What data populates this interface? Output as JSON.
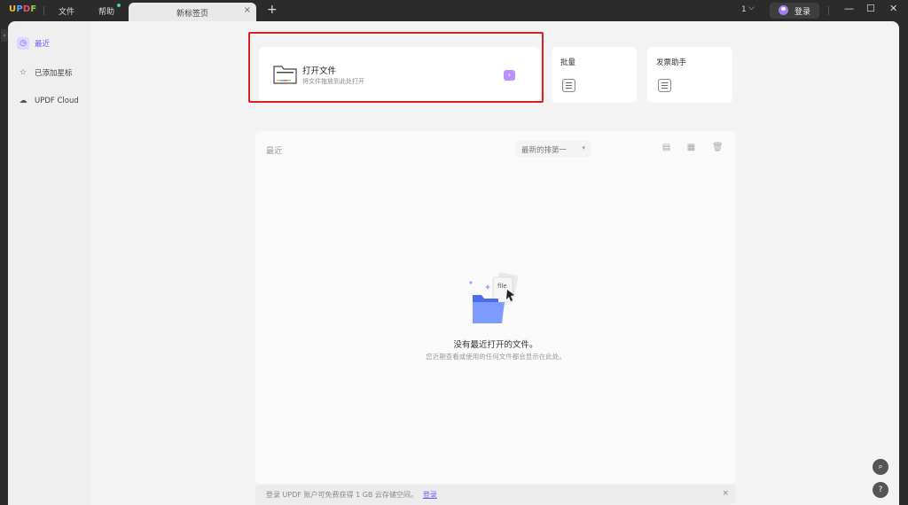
{
  "titlebar": {
    "menu_file": "文件",
    "menu_help": "帮助",
    "tab_label": "新标签页",
    "tab_close": "×",
    "tab_add": "+",
    "page_count": "1",
    "login": "登录"
  },
  "sidebar": {
    "items": [
      {
        "label": "最近",
        "icon": "clock-icon"
      },
      {
        "label": "已添加星标",
        "icon": "star-icon"
      },
      {
        "label": "UPDF Cloud",
        "icon": "cloud-icon"
      }
    ]
  },
  "actions": {
    "open_title": "打开文件",
    "open_sub": "将文件拖放到此处打开",
    "batch_title": "批量",
    "invoice_title": "发票助手"
  },
  "recent": {
    "title": "最近",
    "sort_label": "最新的排第一",
    "empty_title": "没有最近打开的文件。",
    "empty_sub": "您近期查看或使用的任何文件都会显示在此处。"
  },
  "promo": {
    "text": "登录 UPDF 账户可免费获得 1 GB 云存储空间。",
    "link": "登录",
    "close": "×"
  },
  "colors": {
    "accent": "#7a5af8",
    "highlight_border": "#e02020"
  }
}
